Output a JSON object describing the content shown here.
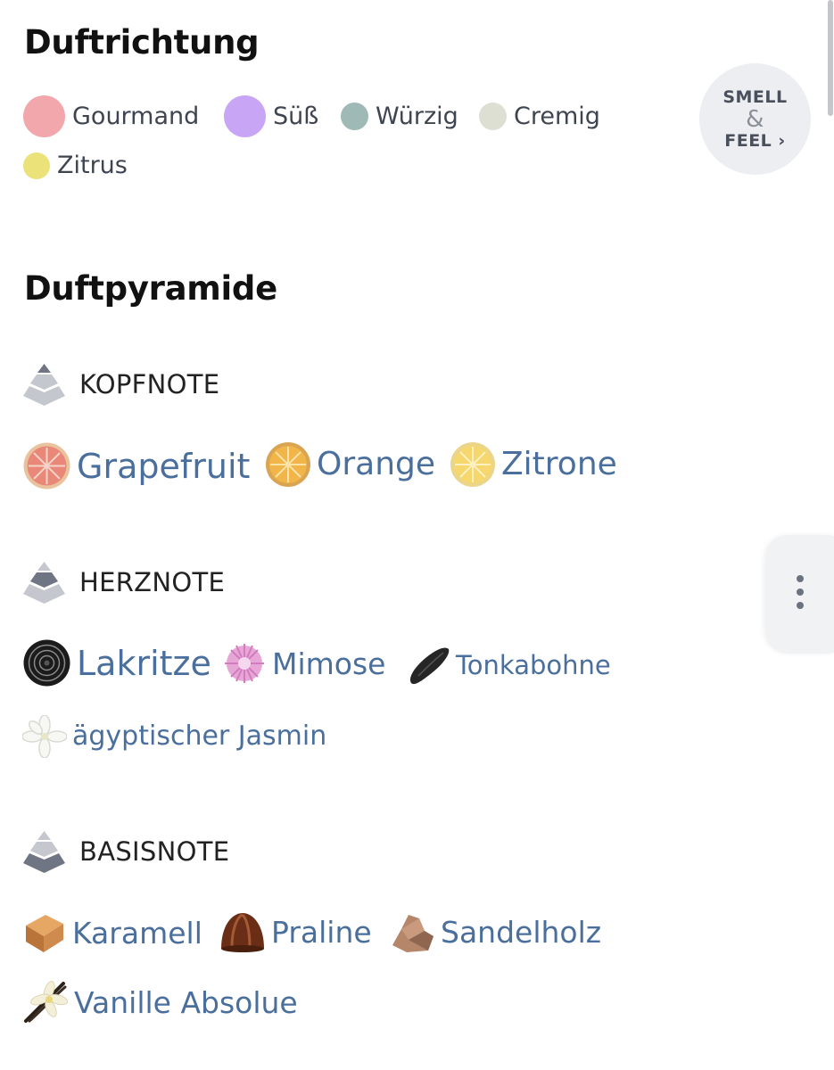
{
  "fragrance_family": {
    "title": "Duftrichtung",
    "categories": [
      {
        "label": "Gourmand",
        "color": "#f2a7ad"
      },
      {
        "label": "Süß",
        "color": "#c9a6f5"
      },
      {
        "label": "Würzig",
        "color": "#9fb9b6"
      },
      {
        "label": "Cremig",
        "color": "#dedfd3"
      },
      {
        "label": "Zitrus",
        "color": "#ebe27a"
      }
    ]
  },
  "smell_feel": {
    "line1": "SMELL",
    "amp": "&",
    "line2": "FEEL",
    "chevron": "›"
  },
  "pyramid": {
    "title": "Duftpyramide",
    "top": {
      "label": "KOPFNOTE",
      "items": [
        {
          "label": "Grapefruit",
          "icon": "grapefruit-icon"
        },
        {
          "label": "Orange",
          "icon": "orange-icon"
        },
        {
          "label": "Zitrone",
          "icon": "lemon-icon"
        }
      ]
    },
    "heart": {
      "label": "HERZNOTE",
      "items": [
        {
          "label": "Lakritze",
          "icon": "licorice-icon"
        },
        {
          "label": "Mimose",
          "icon": "mimosa-icon"
        },
        {
          "label": "Tonkabohne",
          "icon": "tonka-bean-icon"
        },
        {
          "label": "ägyptischer Jasmin",
          "icon": "jasmine-icon"
        }
      ]
    },
    "base": {
      "label": "BASISNOTE",
      "items": [
        {
          "label": "Karamell",
          "icon": "caramel-icon"
        },
        {
          "label": "Praline",
          "icon": "praline-icon"
        },
        {
          "label": "Sandelholz",
          "icon": "sandalwood-icon"
        },
        {
          "label": "Vanille Absolue",
          "icon": "vanilla-icon"
        }
      ]
    }
  },
  "colors": {
    "accent_link": "#4b6f9c",
    "heading": "#111111",
    "pill_bg": "#eceef2"
  }
}
